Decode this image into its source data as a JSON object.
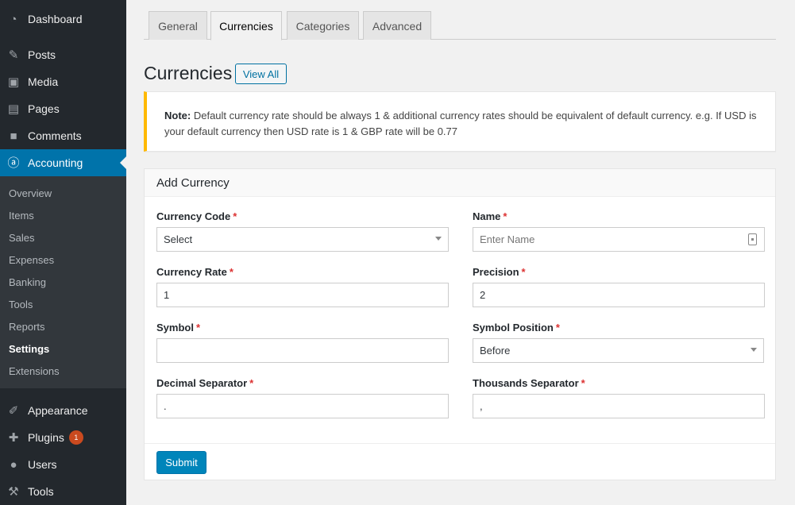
{
  "sidebar": {
    "top_items": [
      {
        "label": "Dashboard",
        "icon": "dashboard-icon"
      },
      {
        "label": "Posts",
        "icon": "pin-icon"
      },
      {
        "label": "Media",
        "icon": "media-icon"
      },
      {
        "label": "Pages",
        "icon": "pages-icon"
      },
      {
        "label": "Comments",
        "icon": "comments-icon"
      },
      {
        "label": "Accounting",
        "icon": "accounting-icon"
      }
    ],
    "submenu": [
      "Overview",
      "Items",
      "Sales",
      "Expenses",
      "Banking",
      "Tools",
      "Reports",
      "Settings",
      "Extensions"
    ],
    "bottom_items": [
      {
        "label": "Appearance",
        "icon": "brush-icon"
      },
      {
        "label": "Plugins",
        "icon": "plugin-icon",
        "badge": "1"
      },
      {
        "label": "Users",
        "icon": "users-icon"
      },
      {
        "label": "Tools",
        "icon": "wrench-icon"
      }
    ]
  },
  "tabs": [
    "General",
    "Currencies",
    "Categories",
    "Advanced"
  ],
  "active_tab": "Currencies",
  "heading": {
    "title": "Currencies",
    "view_all": "View All"
  },
  "notice": {
    "prefix": "Note:",
    "text": "Default currency rate should be always 1 & additional currency rates should be equivalent of default currency. e.g. If USD is your default currency then USD rate is 1 & GBP rate will be 0.77"
  },
  "form": {
    "title": "Add Currency",
    "fields": {
      "currency_code": {
        "label": "Currency Code",
        "value": "Select"
      },
      "name": {
        "label": "Name",
        "placeholder": "Enter Name"
      },
      "currency_rate": {
        "label": "Currency Rate",
        "value": "1"
      },
      "precision": {
        "label": "Precision",
        "value": "2"
      },
      "symbol": {
        "label": "Symbol",
        "value": ""
      },
      "symbol_position": {
        "label": "Symbol Position",
        "value": "Before"
      },
      "decimal_separator": {
        "label": "Decimal Separator",
        "value": "."
      },
      "thousands_separator": {
        "label": "Thousands Separator",
        "value": ","
      }
    },
    "required_mark": "*",
    "submit_label": "Submit"
  },
  "colors": {
    "sidebar_bg": "#23282d",
    "submenu_bg": "#32373c",
    "accent": "#0073aa",
    "notice_border": "#ffb900",
    "required": "#dc3232",
    "badge": "#ca4a1f"
  }
}
